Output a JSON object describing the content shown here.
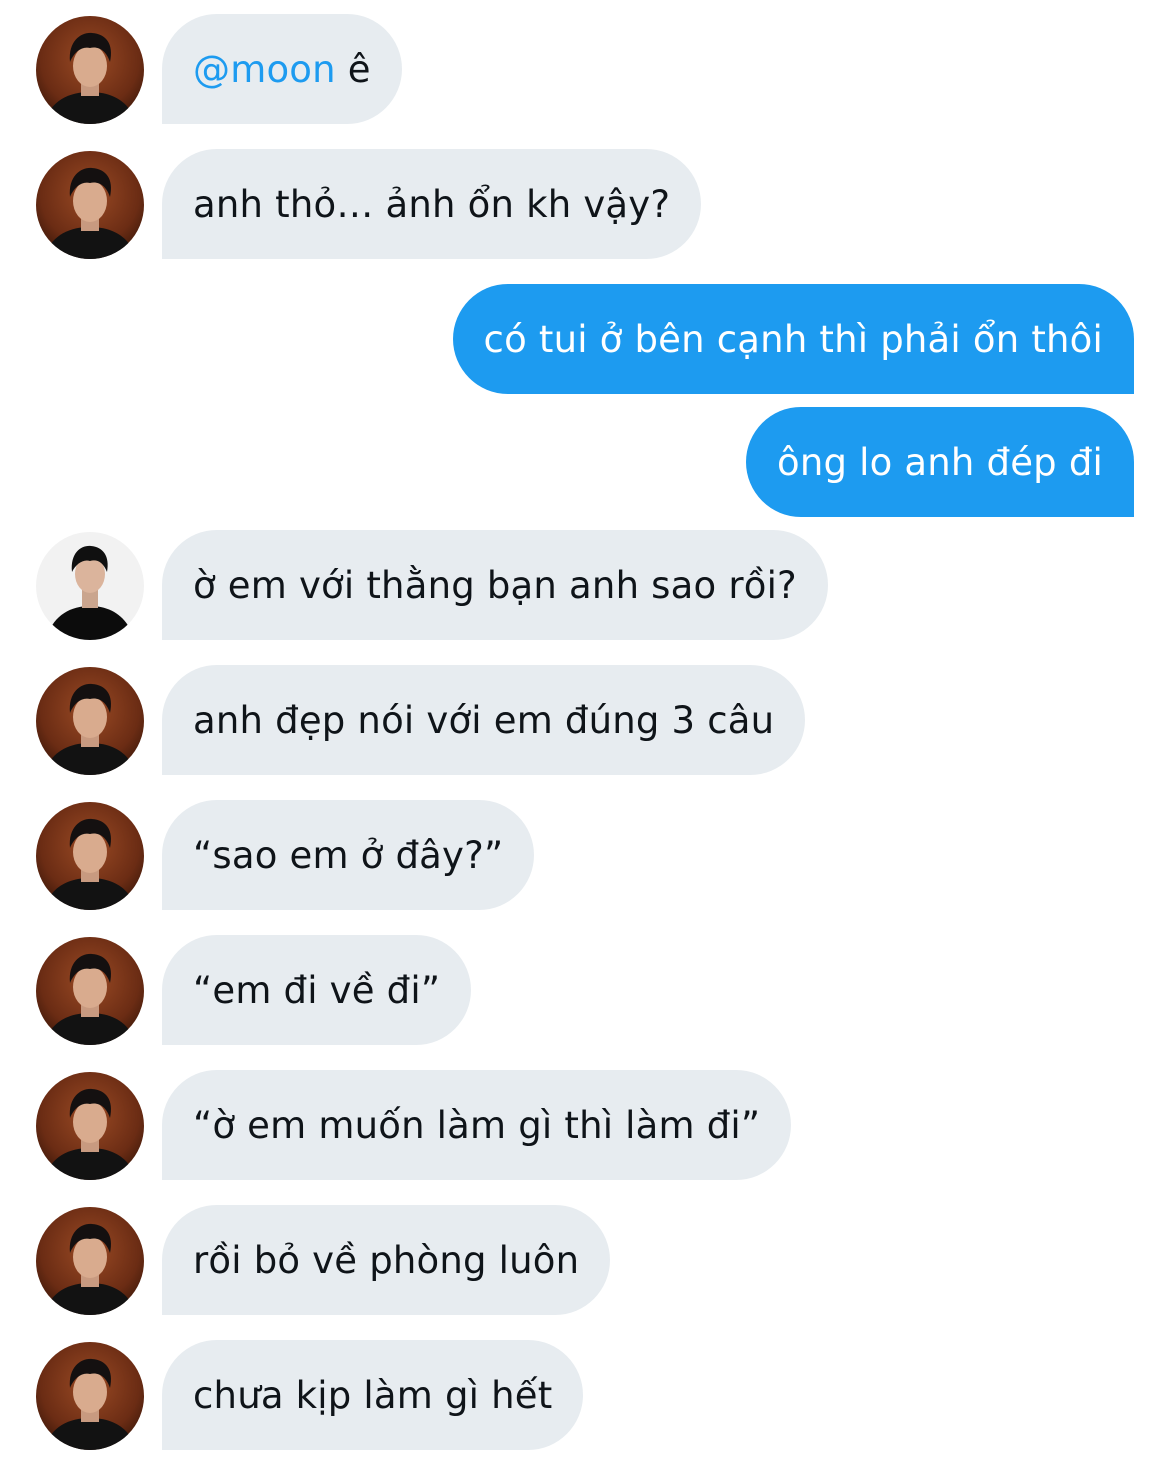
{
  "conversation": {
    "messages": [
      {
        "sender": "other",
        "avatar": "portrait-dark",
        "mention": "@moon",
        "text": " ê"
      },
      {
        "sender": "other",
        "avatar": "portrait-dark",
        "text": "anh thỏ… ảnh ổn kh vậy?"
      },
      {
        "sender": "me",
        "text": "có tui ở bên cạnh thì phải ổn thôi"
      },
      {
        "sender": "me",
        "text": "ông lo anh đép đi"
      },
      {
        "sender": "other",
        "avatar": "portrait-light",
        "text": "ờ em với thằng bạn anh sao rồi?"
      },
      {
        "sender": "other",
        "avatar": "portrait-dark",
        "text": "anh đẹp nói với em đúng 3 câu"
      },
      {
        "sender": "other",
        "avatar": "portrait-dark",
        "text": "“sao em ở đây?”"
      },
      {
        "sender": "other",
        "avatar": "portrait-dark",
        "text": "“em đi về đi”"
      },
      {
        "sender": "other",
        "avatar": "portrait-dark",
        "text": "“ờ em muốn làm gì thì làm đi”"
      },
      {
        "sender": "other",
        "avatar": "portrait-dark",
        "text": "rồi bỏ về phòng luôn"
      },
      {
        "sender": "other",
        "avatar": "portrait-dark",
        "text": "chưa kịp làm gì hết"
      }
    ]
  },
  "colors": {
    "incoming_bubble": "#e7ecf0",
    "outgoing_bubble": "#1d9bf0",
    "mention": "#1d9bf0",
    "text": "#0f1419"
  }
}
